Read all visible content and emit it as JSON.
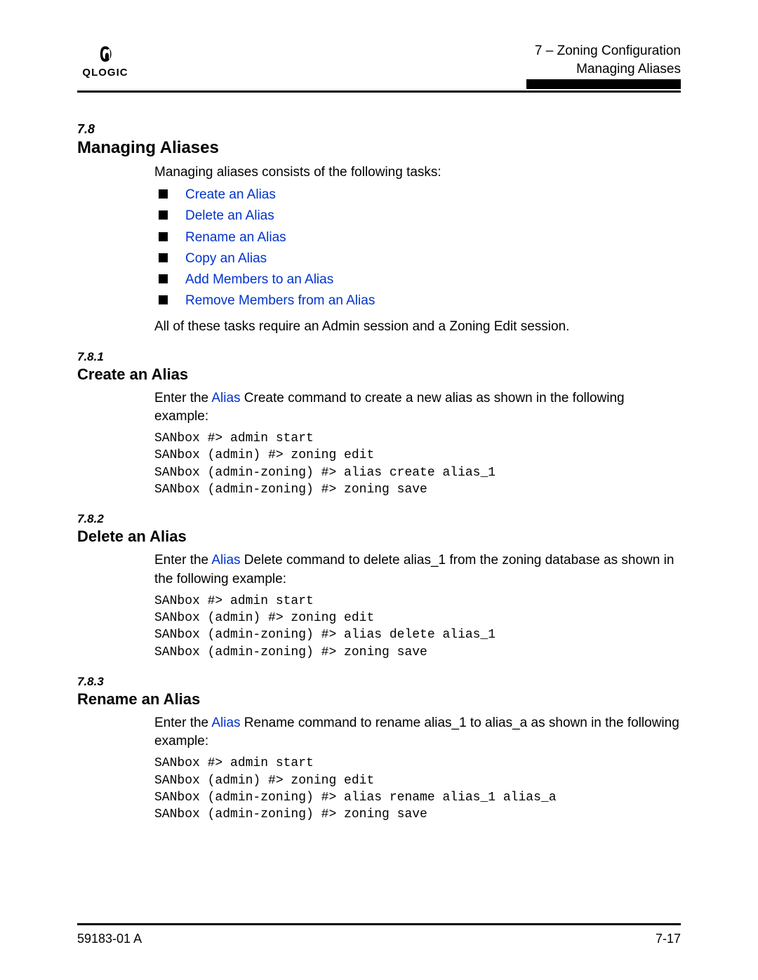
{
  "header": {
    "chapter_line": "7 – Zoning Configuration",
    "section_line": "Managing Aliases",
    "logo_label": "QLOGIC"
  },
  "section78": {
    "num": "7.8",
    "title": "Managing Aliases",
    "intro": "Managing aliases consists of the following tasks:",
    "tasks": [
      "Create an Alias",
      "Delete an Alias",
      "Rename an Alias",
      "Copy an Alias",
      "Add Members to an Alias",
      "Remove Members from an Alias"
    ],
    "closing": "All of these tasks require an Admin session and a Zoning Edit session."
  },
  "section781": {
    "num": "7.8.1",
    "title": "Create an Alias",
    "para_pre": "Enter the ",
    "para_link": "Alias",
    "para_post": " Create command to create a new alias as shown in the following example:",
    "code": "SANbox #> admin start\nSANbox (admin) #> zoning edit\nSANbox (admin-zoning) #> alias create alias_1\nSANbox (admin-zoning) #> zoning save"
  },
  "section782": {
    "num": "7.8.2",
    "title": "Delete an Alias",
    "para_pre": "Enter the ",
    "para_link": "Alias",
    "para_post": " Delete command to delete alias_1 from the zoning database as shown in the following example:",
    "code": "SANbox #> admin start\nSANbox (admin) #> zoning edit\nSANbox (admin-zoning) #> alias delete alias_1\nSANbox (admin-zoning) #> zoning save"
  },
  "section783": {
    "num": "7.8.3",
    "title": "Rename an Alias",
    "para_pre": "Enter the ",
    "para_link": "Alias",
    "para_post": " Rename command to rename alias_1 to alias_a as shown in the following example:",
    "code": "SANbox #> admin start\nSANbox (admin) #> zoning edit\nSANbox (admin-zoning) #> alias rename alias_1 alias_a\nSANbox (admin-zoning) #> zoning save"
  },
  "footer": {
    "left": "59183-01 A",
    "right": "7-17"
  }
}
